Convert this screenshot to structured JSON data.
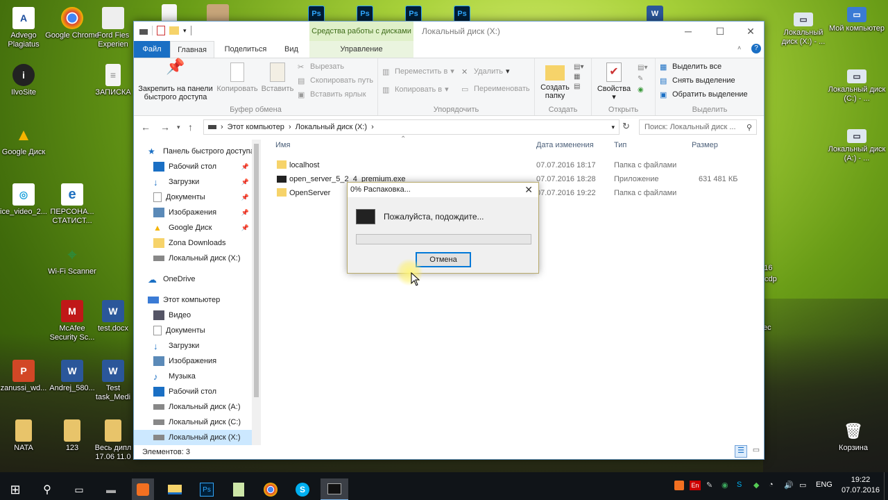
{
  "desktop": {
    "left_icons": [
      {
        "label": "Advego Plagiatus",
        "color": "#1b4d9e",
        "glyph": "A"
      },
      {
        "label": "Google Chrome",
        "color": "#dd4b39",
        "glyph": "◉"
      },
      {
        "label": "Ford Fies Experien",
        "color": "#ffffff",
        "glyph": ""
      },
      {
        "label": "",
        "color": "#f6f6f6",
        "glyph": ""
      },
      {
        "label": "",
        "color": "#c7a57a",
        "glyph": ""
      },
      {
        "label": "IlvoSite",
        "color": "#333333",
        "glyph": "i"
      },
      {
        "label": "ЗАПИСКА",
        "color": "#f4f4f4",
        "glyph": "≡"
      },
      {
        "label": "Google Диск",
        "color": "#f4b400",
        "glyph": "▲"
      },
      {
        "label": "ice_video_2...",
        "color": "#1aa0db",
        "glyph": "◎"
      },
      {
        "label": "ПЕРСОНА... СТАТИСТ...",
        "color": "#1e6fc0",
        "glyph": "e"
      },
      {
        "label": "Wi-Fi Scanner",
        "color": "#2e8a3a",
        "glyph": "⌖"
      },
      {
        "label": "McAfee Security Sc...",
        "color": "#c01818",
        "glyph": "M"
      },
      {
        "label": "test.docx",
        "color": "#2b579a",
        "glyph": "W"
      },
      {
        "label": "zanussi_wd...",
        "color": "#d24726",
        "glyph": "P"
      },
      {
        "label": "Andrej_580...",
        "color": "#2b579a",
        "glyph": "W"
      },
      {
        "label": "Test task_Medi",
        "color": "#2b579a",
        "glyph": "W"
      },
      {
        "label": "NATA",
        "color": "#e8c46a",
        "glyph": ""
      },
      {
        "label": "123",
        "color": "#e8c46a",
        "glyph": ""
      },
      {
        "label": "Весь дипл 17.06 11.0",
        "color": "#e8c46a",
        "glyph": ""
      }
    ],
    "top_icons": [
      {
        "label": "",
        "color": "#001e36",
        "glyph": "Ps"
      },
      {
        "label": "",
        "color": "#001e36",
        "glyph": "Ps"
      },
      {
        "label": "",
        "color": "#001e36",
        "glyph": "Ps"
      },
      {
        "label": "",
        "color": "#001e36",
        "glyph": "Ps"
      },
      {
        "label": "",
        "color": "#2b579a",
        "glyph": "W"
      }
    ],
    "right_icons": [
      {
        "label": "Локальный диск (X:) - ...",
        "glyph": "▭"
      },
      {
        "label": "Мой компьютер",
        "glyph": "▭"
      },
      {
        "label": "Локальный диск (C:) - ...",
        "glyph": "▭"
      },
      {
        "label": "Локальный диск (A:) - ...",
        "glyph": "▭"
      },
      {
        "label": "Корзина",
        "glyph": "🗑"
      }
    ],
    "partial_text": [
      "116",
      "cdp",
      "ес"
    ]
  },
  "window": {
    "title": "Локальный диск (X:)",
    "context_tab": "Средства работы с дисками",
    "tabs": {
      "file": "Файл",
      "home": "Главная",
      "share": "Поделиться",
      "view": "Вид",
      "manage": "Управление"
    },
    "ribbon": {
      "pin": "Закрепить на панели быстрого доступа",
      "copy": "Копировать",
      "paste": "Вставить",
      "cut": "Вырезать",
      "copy_path": "Скопировать путь",
      "paste_shortcut": "Вставить ярлык",
      "clipboard_group": "Буфер обмена",
      "move_to": "Переместить в",
      "copy_to": "Копировать в",
      "delete": "Удалить",
      "rename": "Переименовать",
      "organize_group": "Упорядочить",
      "new_folder": "Создать папку",
      "create_group": "Создать",
      "properties": "Свойства",
      "open_group": "Открыть",
      "select_all": "Выделить все",
      "select_none": "Снять выделение",
      "invert_selection": "Обратить выделение",
      "select_group": "Выделить"
    },
    "address": {
      "root": "Этот компьютер",
      "current": "Локальный диск (X:)",
      "search_placeholder": "Поиск: Локальный диск ..."
    },
    "nav": {
      "quick_access": "Панель быстрого доступа",
      "quick_items": [
        "Рабочий стол",
        "Загрузки",
        "Документы",
        "Изображения",
        "Google Диск",
        "Zona Downloads",
        "Локальный диск (X:)"
      ],
      "onedrive": "OneDrive",
      "this_pc": "Этот компьютер",
      "pc_items": [
        "Видео",
        "Документы",
        "Загрузки",
        "Изображения",
        "Музыка",
        "Рабочий стол",
        "Локальный диск (A:)",
        "Локальный диск (C:)",
        "Локальный диск (X:)"
      ]
    },
    "columns": {
      "name": "Имя",
      "date": "Дата изменения",
      "type": "Тип",
      "size": "Размер"
    },
    "files": [
      {
        "name": "localhost",
        "date": "07.07.2016 18:17",
        "type": "Папка с файлами",
        "size": ""
      },
      {
        "name": "open_server_5_2_4_premium.exe",
        "date": "07.07.2016 18:28",
        "type": "Приложение",
        "size": "631 481 КБ"
      },
      {
        "name": "OpenServer",
        "date": "07.07.2016 19:22",
        "type": "Папка с файлами",
        "size": ""
      }
    ],
    "status": "Элементов: 3"
  },
  "dialog": {
    "title": "0% Распаковка...",
    "message": "Пожалуйста, подождите...",
    "cancel": "Отмена",
    "progress": 0
  },
  "taskbar": {
    "lang": "ENG",
    "time": "19:22",
    "date": "07.07.2016",
    "tray_en": "En"
  },
  "colors": {
    "accent": "#1a6fc4",
    "selection": "#cce8ff",
    "context_tab": "#dff0c9"
  }
}
